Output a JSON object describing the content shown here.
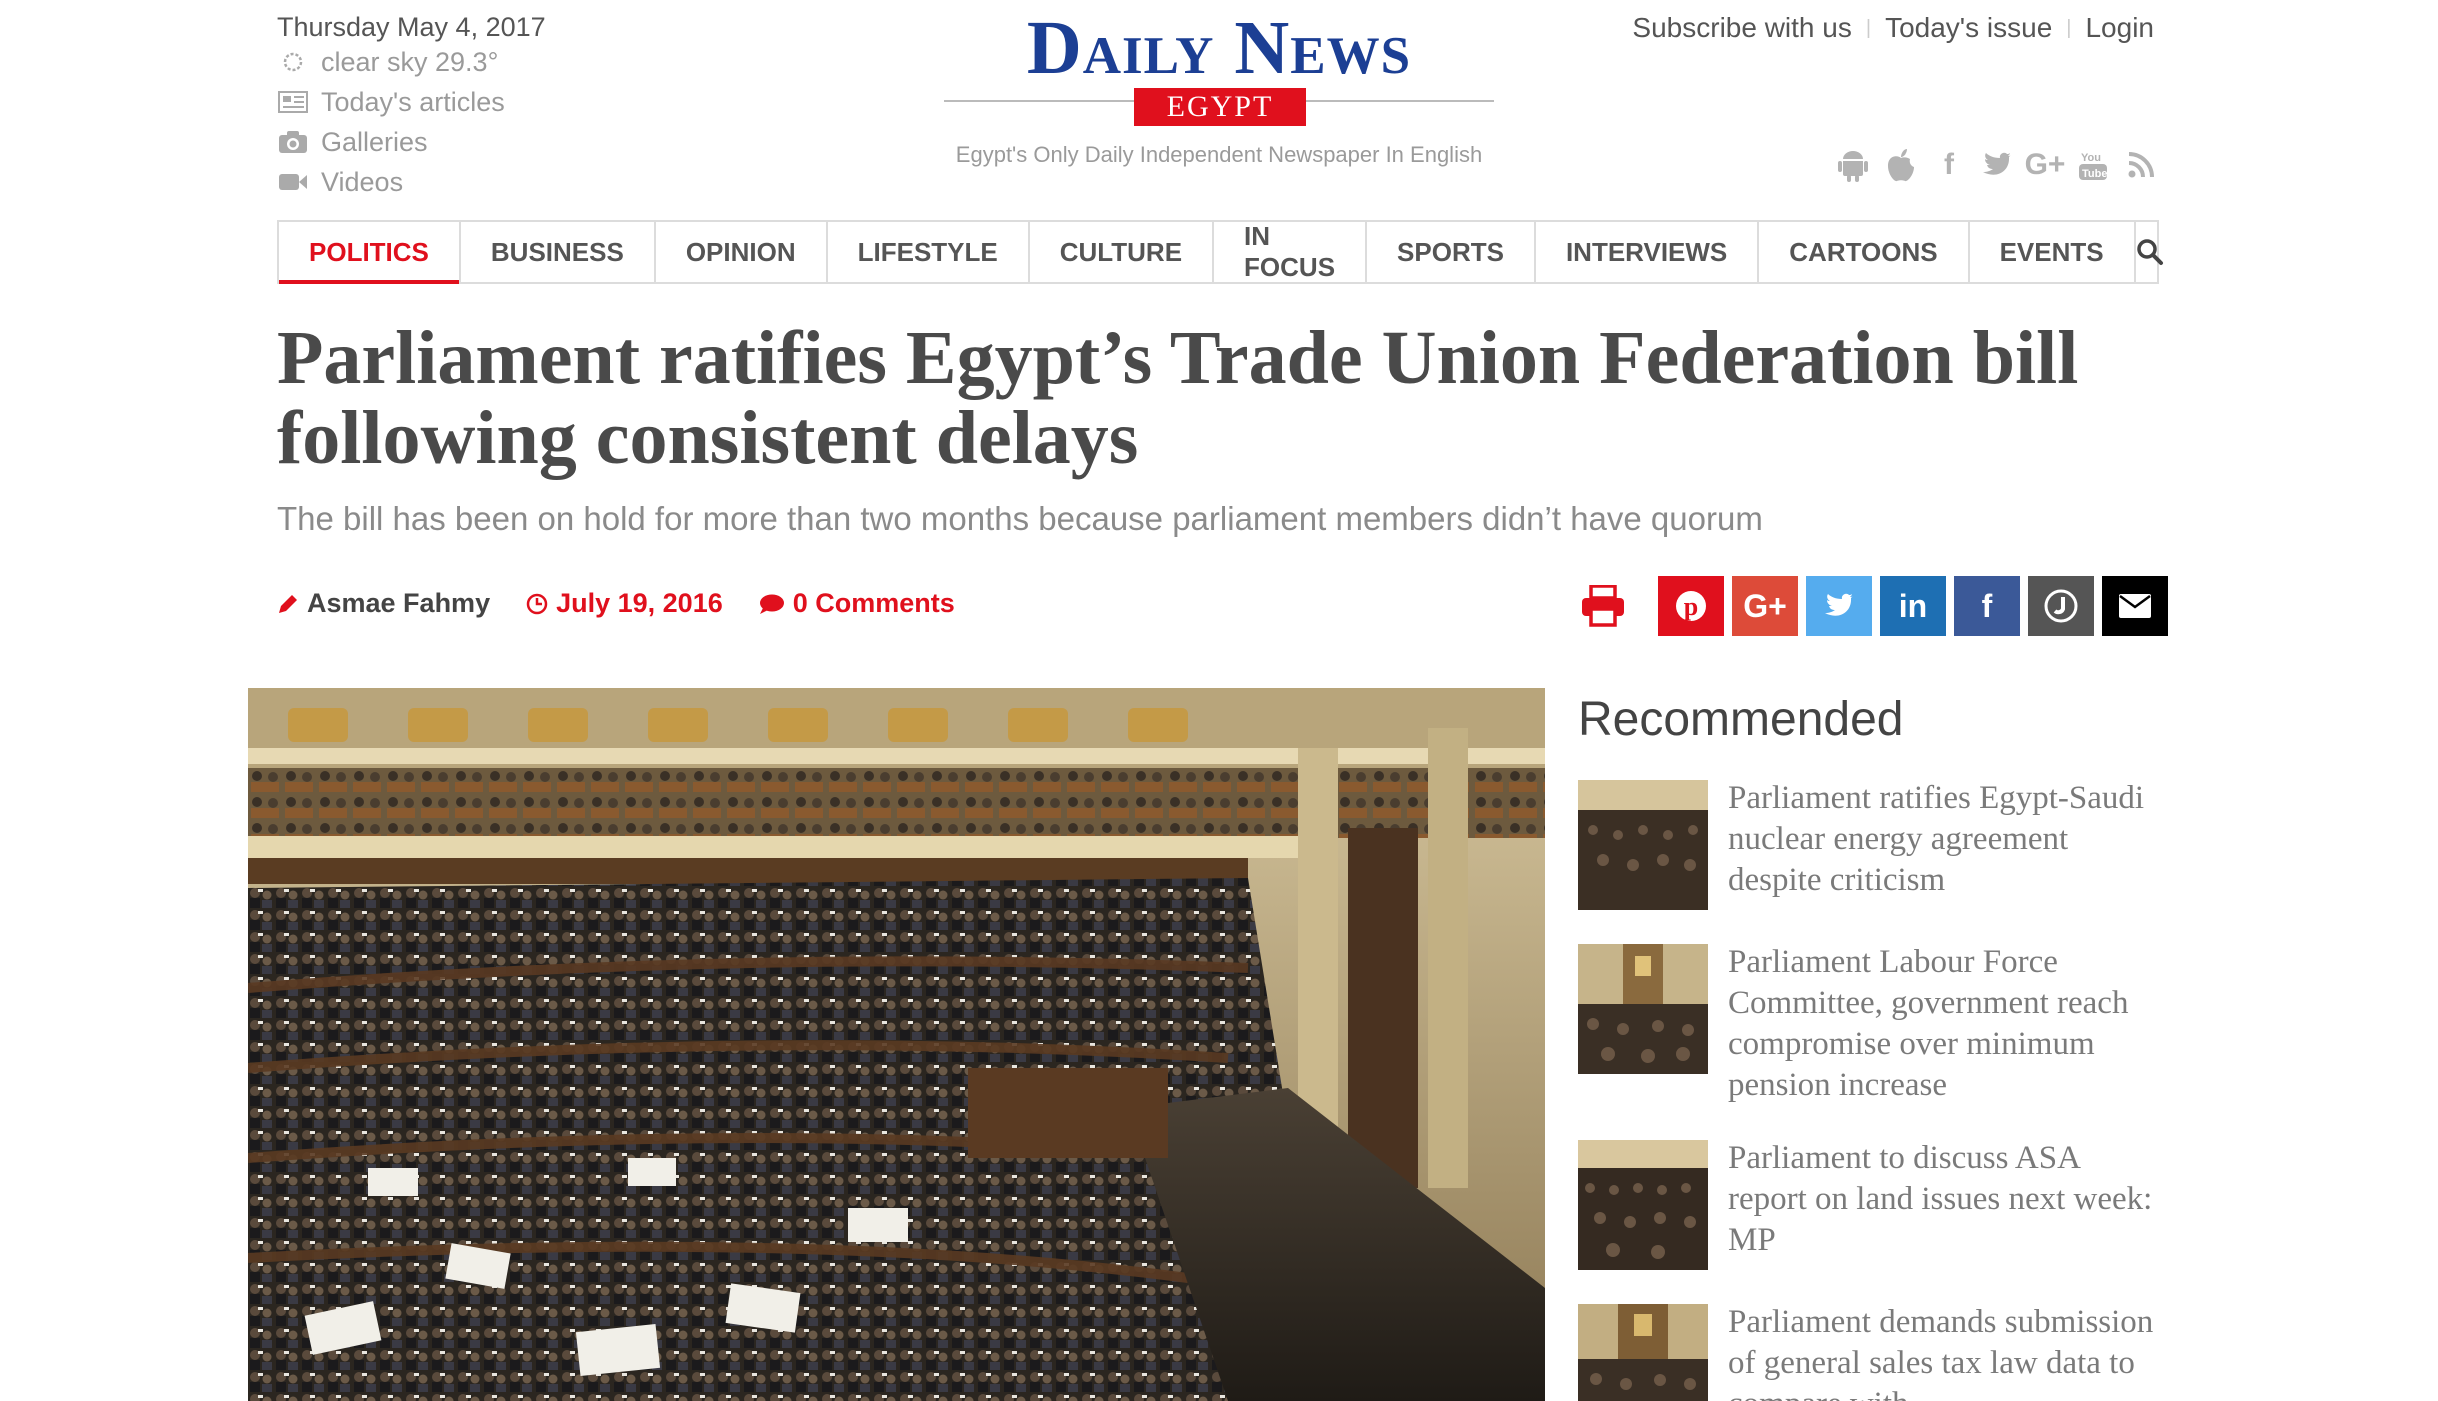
{
  "header": {
    "date": "Thursday May 4, 2017",
    "weather": "clear sky 29.3°",
    "links": [
      "Today's articles",
      "Galleries",
      "Videos"
    ],
    "brand": "Daily News",
    "brand_sub": "EGYPT",
    "tagline": "Egypt's Only Daily Independent Newspaper In English",
    "top_links": [
      "Subscribe with us",
      "Today's issue",
      "Login"
    ],
    "social_icons": [
      "android-icon",
      "apple-icon",
      "facebook-icon",
      "twitter-icon",
      "google-plus-icon",
      "youtube-icon",
      "rss-icon"
    ]
  },
  "nav": {
    "items": [
      "POLITICS",
      "BUSINESS",
      "OPINION",
      "LIFESTYLE",
      "CULTURE",
      "IN FOCUS",
      "SPORTS",
      "INTERVIEWS",
      "CARTOONS",
      "EVENTS"
    ],
    "active": "POLITICS"
  },
  "article": {
    "title": "Parliament ratifies Egypt’s Trade Union Federation bill following consistent delays",
    "subtitle": "The bill has been on hold for more than two months because parliament members didn’t have quorum",
    "author": "Asmae Fahmy",
    "date": "July 19, 2016",
    "comments": "0 Comments"
  },
  "share": {
    "buttons": [
      {
        "name": "pinterest",
        "glyph": "p",
        "color": "#e0101d"
      },
      {
        "name": "google-plus",
        "glyph": "G+",
        "color": "#dd4b39"
      },
      {
        "name": "twitter",
        "glyph": "t",
        "color": "#55acee"
      },
      {
        "name": "linkedin",
        "glyph": "in",
        "color": "#1e6fb3"
      },
      {
        "name": "facebook",
        "glyph": "f",
        "color": "#3b5998"
      },
      {
        "name": "other",
        "glyph": "J",
        "color": "#555555"
      },
      {
        "name": "email",
        "glyph": "✉",
        "color": "#000000"
      }
    ],
    "accent": "#e0101d"
  },
  "sidebar": {
    "title": "Recommended",
    "items": [
      "Parliament ratifies Egypt-Saudi nuclear energy agreement despite criticism",
      "Parliament Labour Force Committee, government reach compromise over minimum pension increase",
      "Parliament to discuss ASA report on land issues next week: MP",
      "Parliament demands submission of general sales tax law data to compare with"
    ]
  }
}
